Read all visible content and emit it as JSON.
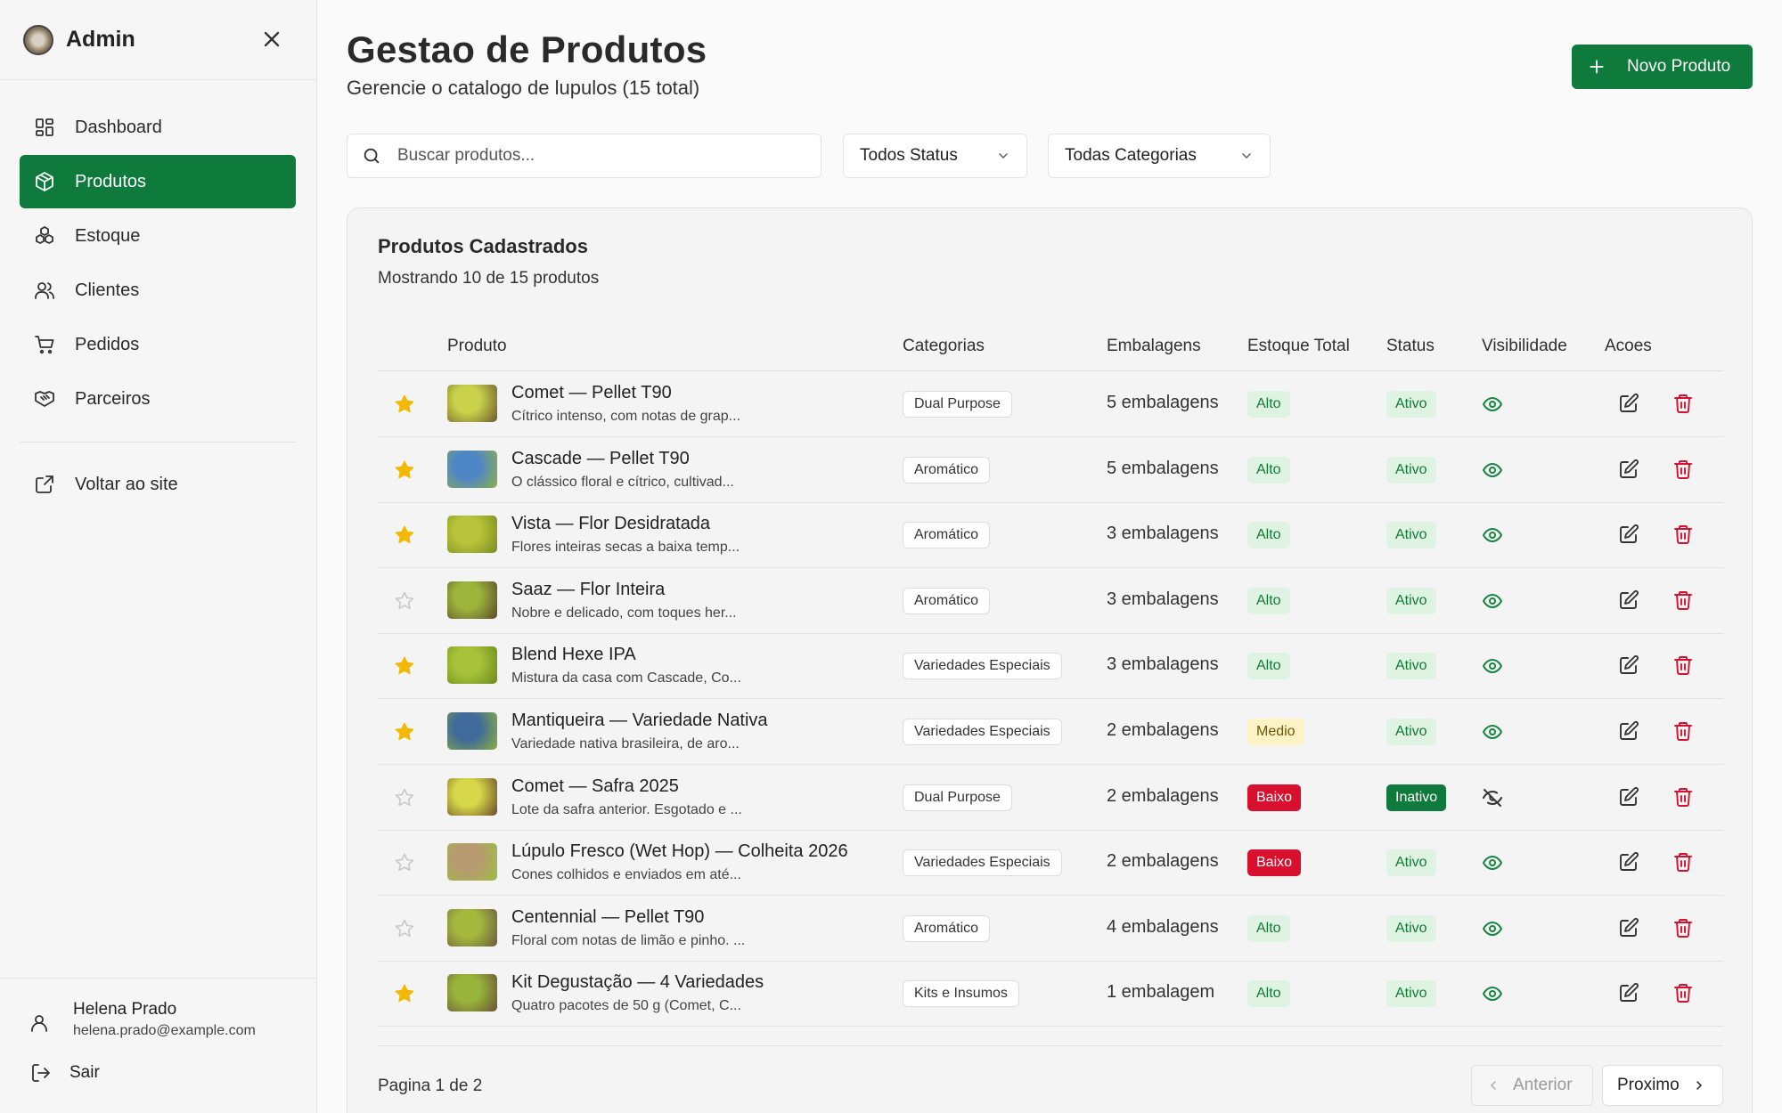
{
  "sidebar": {
    "title": "Admin",
    "items": [
      {
        "label": "Dashboard",
        "icon": "dashboard-icon",
        "active": false
      },
      {
        "label": "Produtos",
        "icon": "package-icon",
        "active": true
      },
      {
        "label": "Estoque",
        "icon": "boxes-icon",
        "active": false
      },
      {
        "label": "Clientes",
        "icon": "users-icon",
        "active": false
      },
      {
        "label": "Pedidos",
        "icon": "cart-icon",
        "active": false
      },
      {
        "label": "Parceiros",
        "icon": "handshake-icon",
        "active": false
      }
    ],
    "back_label": "Voltar ao site",
    "user": {
      "name": "Helena Prado",
      "email": "helena.prado@example.com"
    },
    "logout_label": "Sair"
  },
  "header": {
    "title": "Gestao de Produtos",
    "subtitle": "Gerencie o catalogo de lupulos (15 total)",
    "new_button": "Novo Produto"
  },
  "filters": {
    "search_placeholder": "Buscar produtos...",
    "status": "Todos Status",
    "category": "Todas Categorias"
  },
  "table": {
    "title": "Produtos Cadastrados",
    "subtitle": "Mostrando 10 de 15 produtos",
    "columns": [
      "Produto",
      "Categorias",
      "Embalagens",
      "Estoque Total",
      "Status",
      "Visibilidade",
      "Acoes"
    ],
    "rows": [
      {
        "starred": true,
        "name": "Comet — Pellet T90",
        "desc": "Cítrico intenso, com notas de grap...",
        "category": "Dual Purpose",
        "packages": "5 embalagens",
        "stock": "Alto",
        "status": "Ativo",
        "visible": true
      },
      {
        "starred": true,
        "name": "Cascade — Pellet T90",
        "desc": "O clássico floral e cítrico, cultivad...",
        "category": "Aromático",
        "packages": "5 embalagens",
        "stock": "Alto",
        "status": "Ativo",
        "visible": true
      },
      {
        "starred": true,
        "name": "Vista — Flor Desidratada",
        "desc": "Flores inteiras secas a baixa temp...",
        "category": "Aromático",
        "packages": "3 embalagens",
        "stock": "Alto",
        "status": "Ativo",
        "visible": true
      },
      {
        "starred": false,
        "name": "Saaz — Flor Inteira",
        "desc": "Nobre e delicado, com toques her...",
        "category": "Aromático",
        "packages": "3 embalagens",
        "stock": "Alto",
        "status": "Ativo",
        "visible": true
      },
      {
        "starred": true,
        "name": "Blend Hexe IPA",
        "desc": "Mistura da casa com Cascade, Co...",
        "category": "Variedades Especiais",
        "packages": "3 embalagens",
        "stock": "Alto",
        "status": "Ativo",
        "visible": true
      },
      {
        "starred": true,
        "name": "Mantiqueira — Variedade Nativa",
        "desc": "Variedade nativa brasileira, de aro...",
        "category": "Variedades Especiais",
        "packages": "2 embalagens",
        "stock": "Medio",
        "status": "Ativo",
        "visible": true
      },
      {
        "starred": false,
        "name": "Comet — Safra 2025",
        "desc": "Lote da safra anterior. Esgotado e ...",
        "category": "Dual Purpose",
        "packages": "2 embalagens",
        "stock": "Baixo",
        "status": "Inativo",
        "visible": false
      },
      {
        "starred": false,
        "name": "Lúpulo Fresco (Wet Hop) — Colheita 2026",
        "desc": "Cones colhidos e enviados em até...",
        "category": "Variedades Especiais",
        "packages": "2 embalagens",
        "stock": "Baixo",
        "status": "Ativo",
        "visible": true
      },
      {
        "starred": false,
        "name": "Centennial — Pellet T90",
        "desc": "Floral com notas de limão e pinho. ...",
        "category": "Aromático",
        "packages": "4 embalagens",
        "stock": "Alto",
        "status": "Ativo",
        "visible": true
      },
      {
        "starred": true,
        "name": "Kit Degustação — 4 Variedades",
        "desc": "Quatro pacotes de 50 g (Comet, C...",
        "category": "Kits e Insumos",
        "packages": "1 embalagem",
        "stock": "Alto",
        "status": "Ativo",
        "visible": true
      }
    ]
  },
  "pagination": {
    "info": "Pagina 1 de 2",
    "prev": "Anterior",
    "next": "Proximo"
  },
  "colors": {
    "primary": "#0e7a3b",
    "danger": "#d8102d",
    "star": "#f5b800"
  }
}
